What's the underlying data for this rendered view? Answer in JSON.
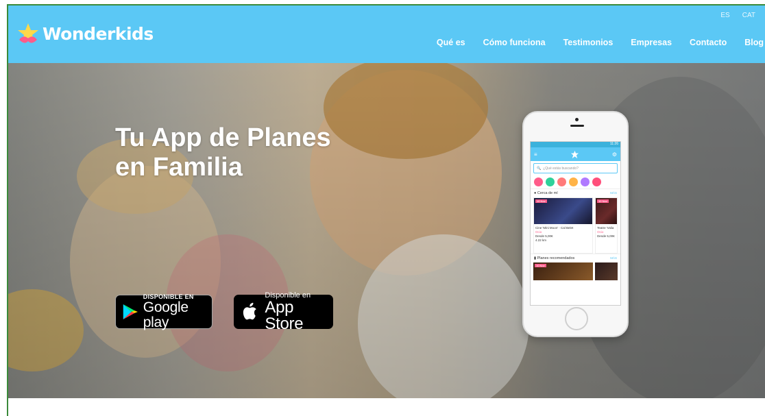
{
  "brand": {
    "name": "Wonderkids"
  },
  "lang": [
    "ES",
    "CAT"
  ],
  "nav": [
    "Qué es",
    "Cómo funciona",
    "Testimonios",
    "Empresas",
    "Contacto",
    "Blog"
  ],
  "hero": {
    "title_line1": "Tu App de Planes",
    "title_line2": "en Familia"
  },
  "stores": {
    "google": {
      "small": "DISPONIBLE EN",
      "big": "Google play"
    },
    "apple": {
      "small": "Disponible en",
      "big": "App Store"
    }
  },
  "app": {
    "time": "11:26",
    "search_placeholder": "¿Qué estás buscando?",
    "near_label": "Cerca de mí",
    "recommended_label": "Planes recomendados",
    "more_label": "MÁS",
    "card1": {
      "tag": "10 Nov",
      "title": "Cine 'Mini Moon' · Cal Belet",
      "type": "Ocio",
      "dist": "4.22 km",
      "price": "Desde 5,00€"
    },
    "card2": {
      "tag": "10 Nov",
      "title": "Teatre 'Valia",
      "type": "Ocio",
      "price": "Desde 5,00€"
    },
    "card3": {
      "tag": "10 Nov"
    }
  },
  "colors": {
    "header": "#5bc8f5",
    "accent_pink": "#ff5c8a"
  }
}
